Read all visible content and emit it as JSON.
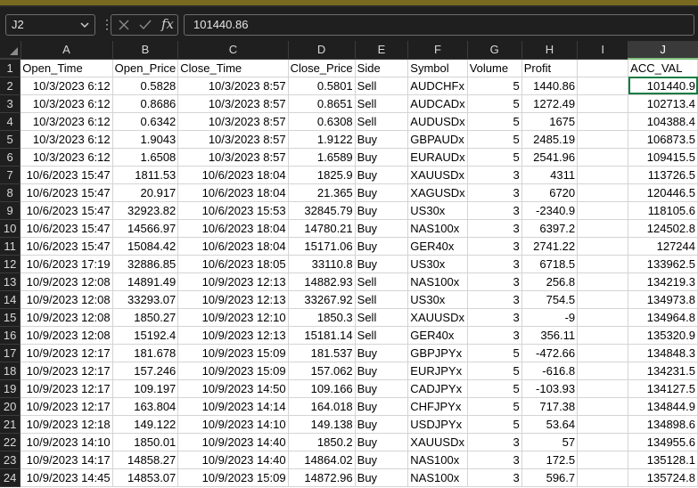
{
  "formula_bar": {
    "name_box": "J2",
    "value": "101440.86",
    "fx_label": "fx"
  },
  "columns": [
    "A",
    "B",
    "C",
    "D",
    "E",
    "F",
    "G",
    "H",
    "I",
    "J"
  ],
  "header_row": [
    "Open_Time",
    "Open_Price",
    "Close_Time",
    "Close_Price",
    "Side",
    "Symbol",
    "Volume",
    "Profit",
    "",
    "ACC_VAL"
  ],
  "rows": [
    {
      "n": "2",
      "cells": [
        "10/3/2023 6:12",
        "0.5828",
        "10/3/2023 8:57",
        "0.5801",
        "Sell",
        "AUDCHFx",
        "5",
        "1440.86",
        "",
        "101440.9"
      ]
    },
    {
      "n": "3",
      "cells": [
        "10/3/2023 6:12",
        "0.8686",
        "10/3/2023 8:57",
        "0.8651",
        "Sell",
        "AUDCADx",
        "5",
        "1272.49",
        "",
        "102713.4"
      ]
    },
    {
      "n": "4",
      "cells": [
        "10/3/2023 6:12",
        "0.6342",
        "10/3/2023 8:57",
        "0.6308",
        "Sell",
        "AUDUSDx",
        "5",
        "1675",
        "",
        "104388.4"
      ]
    },
    {
      "n": "5",
      "cells": [
        "10/3/2023 6:12",
        "1.9043",
        "10/3/2023 8:57",
        "1.9122",
        "Buy",
        "GBPAUDx",
        "5",
        "2485.19",
        "",
        "106873.5"
      ]
    },
    {
      "n": "6",
      "cells": [
        "10/3/2023 6:12",
        "1.6508",
        "10/3/2023 8:57",
        "1.6589",
        "Buy",
        "EURAUDx",
        "5",
        "2541.96",
        "",
        "109415.5"
      ]
    },
    {
      "n": "7",
      "cells": [
        "10/6/2023 15:47",
        "1811.53",
        "10/6/2023 18:04",
        "1825.9",
        "Buy",
        "XAUUSDx",
        "3",
        "4311",
        "",
        "113726.5"
      ]
    },
    {
      "n": "8",
      "cells": [
        "10/6/2023 15:47",
        "20.917",
        "10/6/2023 18:04",
        "21.365",
        "Buy",
        "XAGUSDx",
        "3",
        "6720",
        "",
        "120446.5"
      ]
    },
    {
      "n": "9",
      "cells": [
        "10/6/2023 15:47",
        "32923.82",
        "10/6/2023 15:53",
        "32845.79",
        "Buy",
        "US30x",
        "3",
        "-2340.9",
        "",
        "118105.6"
      ]
    },
    {
      "n": "10",
      "cells": [
        "10/6/2023 15:47",
        "14566.97",
        "10/6/2023 18:04",
        "14780.21",
        "Buy",
        "NAS100x",
        "3",
        "6397.2",
        "",
        "124502.8"
      ]
    },
    {
      "n": "11",
      "cells": [
        "10/6/2023 15:47",
        "15084.42",
        "10/6/2023 18:04",
        "15171.06",
        "Buy",
        "GER40x",
        "3",
        "2741.22",
        "",
        "127244"
      ]
    },
    {
      "n": "12",
      "cells": [
        "10/6/2023 17:19",
        "32886.85",
        "10/6/2023 18:05",
        "33110.8",
        "Buy",
        "US30x",
        "3",
        "6718.5",
        "",
        "133962.5"
      ]
    },
    {
      "n": "13",
      "cells": [
        "10/9/2023 12:08",
        "14891.49",
        "10/9/2023 12:13",
        "14882.93",
        "Sell",
        "NAS100x",
        "3",
        "256.8",
        "",
        "134219.3"
      ]
    },
    {
      "n": "14",
      "cells": [
        "10/9/2023 12:08",
        "33293.07",
        "10/9/2023 12:13",
        "33267.92",
        "Sell",
        "US30x",
        "3",
        "754.5",
        "",
        "134973.8"
      ]
    },
    {
      "n": "15",
      "cells": [
        "10/9/2023 12:08",
        "1850.27",
        "10/9/2023 12:10",
        "1850.3",
        "Sell",
        "XAUUSDx",
        "3",
        "-9",
        "",
        "134964.8"
      ]
    },
    {
      "n": "16",
      "cells": [
        "10/9/2023 12:08",
        "15192.4",
        "10/9/2023 12:13",
        "15181.14",
        "Sell",
        "GER40x",
        "3",
        "356.11",
        "",
        "135320.9"
      ]
    },
    {
      "n": "17",
      "cells": [
        "10/9/2023 12:17",
        "181.678",
        "10/9/2023 15:09",
        "181.537",
        "Buy",
        "GBPJPYx",
        "5",
        "-472.66",
        "",
        "134848.3"
      ]
    },
    {
      "n": "18",
      "cells": [
        "10/9/2023 12:17",
        "157.246",
        "10/9/2023 15:09",
        "157.062",
        "Buy",
        "EURJPYx",
        "5",
        "-616.8",
        "",
        "134231.5"
      ]
    },
    {
      "n": "19",
      "cells": [
        "10/9/2023 12:17",
        "109.197",
        "10/9/2023 14:50",
        "109.166",
        "Buy",
        "CADJPYx",
        "5",
        "-103.93",
        "",
        "134127.5"
      ]
    },
    {
      "n": "20",
      "cells": [
        "10/9/2023 12:17",
        "163.804",
        "10/9/2023 14:14",
        "164.018",
        "Buy",
        "CHFJPYx",
        "5",
        "717.38",
        "",
        "134844.9"
      ]
    },
    {
      "n": "21",
      "cells": [
        "10/9/2023 12:18",
        "149.122",
        "10/9/2023 14:10",
        "149.138",
        "Buy",
        "USDJPYx",
        "5",
        "53.64",
        "",
        "134898.6"
      ]
    },
    {
      "n": "22",
      "cells": [
        "10/9/2023 14:10",
        "1850.01",
        "10/9/2023 14:40",
        "1850.2",
        "Buy",
        "XAUUSDx",
        "3",
        "57",
        "",
        "134955.6"
      ]
    },
    {
      "n": "23",
      "cells": [
        "10/9/2023 14:17",
        "14858.27",
        "10/9/2023 14:40",
        "14864.02",
        "Buy",
        "NAS100x",
        "3",
        "172.5",
        "",
        "135128.1"
      ]
    },
    {
      "n": "24",
      "cells": [
        "10/9/2023 14:45",
        "14853.07",
        "10/9/2023 15:09",
        "14872.96",
        "Buy",
        "NAS100x",
        "3",
        "596.7",
        "",
        "135724.8"
      ]
    }
  ]
}
